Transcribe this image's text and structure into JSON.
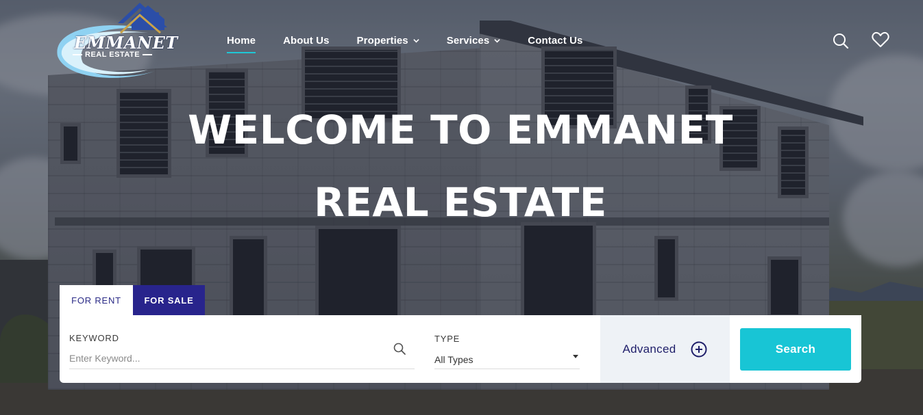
{
  "brand": {
    "name": "EMMANET",
    "tagline": "REAL ESTATE",
    "colors": {
      "navy": "#28248c",
      "accent": "#1ec7d6",
      "logo_blue": "#2b4ea8",
      "logo_gold": "#c8a24a"
    }
  },
  "nav": {
    "items": [
      {
        "label": "Home",
        "active": true
      },
      {
        "label": "About Us"
      },
      {
        "label": "Properties",
        "dropdown": true
      },
      {
        "label": "Services",
        "dropdown": true
      },
      {
        "label": "Contact Us"
      }
    ],
    "icons": [
      "search-icon",
      "heart-icon"
    ]
  },
  "hero": {
    "line1": "WELCOME TO EMMANET",
    "line2": "REAL ESTATE"
  },
  "search": {
    "tabs": [
      {
        "label": "FOR RENT",
        "active": false
      },
      {
        "label": "FOR SALE",
        "active": true
      }
    ],
    "keyword_label": "KEYWORD",
    "keyword_placeholder": "Enter Keyword...",
    "keyword_value": "",
    "type_label": "TYPE",
    "type_value": "All Types",
    "advanced_label": "Advanced",
    "search_button": "Search"
  }
}
